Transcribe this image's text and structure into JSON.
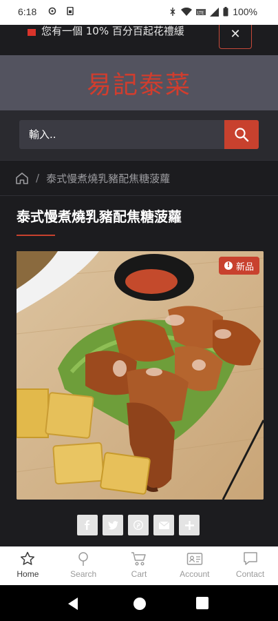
{
  "status_bar": {
    "time": "6:18",
    "battery": "100%"
  },
  "announcement": {
    "text": "您有一個 10% 百分百起花禮緩",
    "close_label": "✕"
  },
  "brand": {
    "logo_text": "易記泰菜"
  },
  "search": {
    "placeholder": "輸入.."
  },
  "breadcrumb": {
    "separator": "/",
    "current": "泰式慢煮燒乳豬配焦糖菠蘿"
  },
  "product": {
    "title": "泰式慢煮燒乳豬配焦糖菠蘿",
    "badge": "新品",
    "badge_icon": "!"
  },
  "share": {
    "facebook": "f",
    "twitter": "t",
    "pinterest": "p",
    "email": "✉",
    "more": "+"
  },
  "bottom_nav": {
    "items": [
      {
        "label": "Home",
        "icon": "star-icon"
      },
      {
        "label": "Search",
        "icon": "search-icon"
      },
      {
        "label": "Cart",
        "icon": "cart-icon"
      },
      {
        "label": "Account",
        "icon": "account-card-icon"
      },
      {
        "label": "Contact",
        "icon": "chat-bubble-icon"
      }
    ]
  },
  "colors": {
    "accent": "#c8412e",
    "header_bg": "#53535f",
    "page_bg": "#1c1c1f"
  }
}
